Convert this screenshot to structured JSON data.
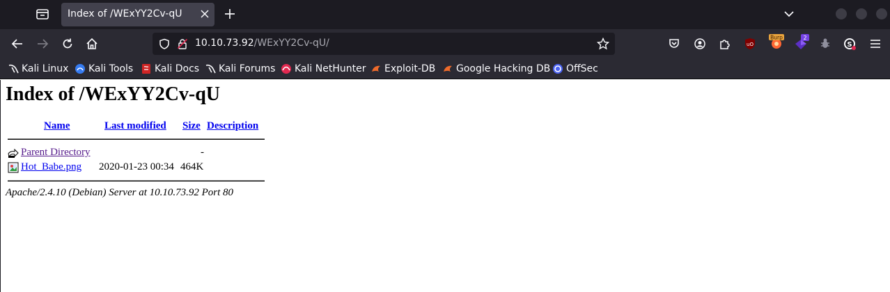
{
  "browser": {
    "tab": {
      "title": "Index of /WExYY2Cv-qU"
    },
    "url": {
      "host": "10.10.73.92",
      "path": "/WExYY2Cv-qU/"
    },
    "extensions": {
      "burp_label": "Burp",
      "badge_count": "2"
    },
    "bookmarks": [
      {
        "label": "Kali Linux",
        "icon": "kali-dragon-icon"
      },
      {
        "label": "Kali Tools",
        "icon": "kali-tools-icon"
      },
      {
        "label": "Kali Docs",
        "icon": "kali-docs-icon"
      },
      {
        "label": "Kali Forums",
        "icon": "kali-dragon-icon"
      },
      {
        "label": "Kali NetHunter",
        "icon": "nethunter-icon"
      },
      {
        "label": "Exploit-DB",
        "icon": "exploit-db-icon"
      },
      {
        "label": "Google Hacking DB",
        "icon": "exploit-db-icon"
      },
      {
        "label": "OffSec",
        "icon": "offsec-icon"
      }
    ]
  },
  "page": {
    "title": "Index of /WExYY2Cv-qU",
    "columns": {
      "name": "Name",
      "modified": "Last modified",
      "size": "Size",
      "description": "Description"
    },
    "rows": [
      {
        "name": "Parent Directory",
        "modified": "",
        "size": "-",
        "icon": "back-icon"
      },
      {
        "name": "Hot_Babe.png",
        "modified": "2020-01-23 00:34",
        "size": "464K",
        "icon": "image-icon"
      }
    ],
    "address": "Apache/2.4.10 (Debian) Server at 10.10.73.92 Port 80"
  },
  "colors": {
    "visited_link": "#551a8b",
    "link": "#0000ee",
    "chrome_dark": "#1c1b22",
    "chrome": "#2b2a33"
  }
}
